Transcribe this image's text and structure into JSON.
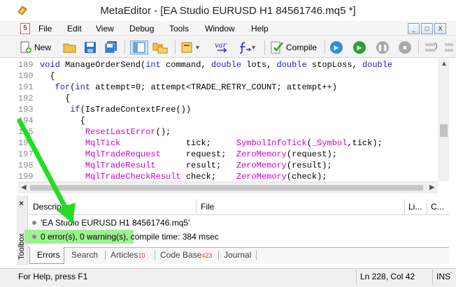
{
  "window": {
    "title": "MetaEditor - [EA Studio EURUSD H1 84561746.mq5 *]"
  },
  "menu": [
    "File",
    "Edit",
    "View",
    "Debug",
    "Tools",
    "Window",
    "Help"
  ],
  "window_controls": [
    "_",
    "□",
    "X"
  ],
  "toolbar": {
    "new_label": "New",
    "compile_label": "Compile",
    "var_label": "var"
  },
  "editor": {
    "lines": [
      {
        "num": "189",
        "parts": [
          {
            "t": "kw",
            "s": "void "
          },
          {
            "t": "tx",
            "s": "ManageOrderSend("
          },
          {
            "t": "kw",
            "s": "int"
          },
          {
            "t": "tx",
            "s": " command, "
          },
          {
            "t": "kw",
            "s": "double"
          },
          {
            "t": "tx",
            "s": " lots, "
          },
          {
            "t": "kw",
            "s": "double"
          },
          {
            "t": "tx",
            "s": " stopLoss, "
          },
          {
            "t": "kw",
            "s": "double"
          }
        ]
      },
      {
        "num": "190",
        "parts": [
          {
            "t": "tx",
            "s": "  {"
          }
        ]
      },
      {
        "num": "191",
        "parts": [
          {
            "t": "tx",
            "s": "   "
          },
          {
            "t": "kw",
            "s": "for"
          },
          {
            "t": "tx",
            "s": "("
          },
          {
            "t": "kw",
            "s": "int"
          },
          {
            "t": "tx",
            "s": " attempt=0; attempt<TRADE_RETRY_COUNT; attempt++)"
          }
        ]
      },
      {
        "num": "192",
        "parts": [
          {
            "t": "tx",
            "s": "     {"
          }
        ]
      },
      {
        "num": "193",
        "parts": [
          {
            "t": "tx",
            "s": "      "
          },
          {
            "t": "kw",
            "s": "if"
          },
          {
            "t": "tx",
            "s": "(IsTradeContextFree())"
          }
        ]
      },
      {
        "num": "194",
        "parts": [
          {
            "t": "tx",
            "s": "        {"
          }
        ]
      },
      {
        "num": "195",
        "parts": [
          {
            "t": "tx",
            "s": "         "
          },
          {
            "t": "fn",
            "s": "ResetLastError"
          },
          {
            "t": "tx",
            "s": "();"
          }
        ]
      },
      {
        "num": "196",
        "parts": [
          {
            "t": "tx",
            "s": "         "
          },
          {
            "t": "fn",
            "s": "MqlTick"
          },
          {
            "t": "tx",
            "s": "             tick;     "
          },
          {
            "t": "fn",
            "s": "SymbolInfoTick"
          },
          {
            "t": "tx",
            "s": "("
          },
          {
            "t": "fn",
            "s": "_Symbol"
          },
          {
            "t": "tx",
            "s": ",tick);"
          }
        ]
      },
      {
        "num": "197",
        "parts": [
          {
            "t": "tx",
            "s": "         "
          },
          {
            "t": "fn",
            "s": "MqlTradeRequest"
          },
          {
            "t": "tx",
            "s": "     request;  "
          },
          {
            "t": "fn",
            "s": "ZeroMemory"
          },
          {
            "t": "tx",
            "s": "(request);"
          }
        ]
      },
      {
        "num": "198",
        "parts": [
          {
            "t": "tx",
            "s": "         "
          },
          {
            "t": "fn",
            "s": "MqlTradeResult"
          },
          {
            "t": "tx",
            "s": "      result;   "
          },
          {
            "t": "fn",
            "s": "ZeroMemory"
          },
          {
            "t": "tx",
            "s": "(result);"
          }
        ]
      },
      {
        "num": "199",
        "parts": [
          {
            "t": "tx",
            "s": "         "
          },
          {
            "t": "fn",
            "s": "MqlTradeCheckResult"
          },
          {
            "t": "tx",
            "s": " check;    "
          },
          {
            "t": "fn",
            "s": "ZeroMemory"
          },
          {
            "t": "tx",
            "s": "(check);"
          }
        ]
      }
    ]
  },
  "toolbox": {
    "label": "Toolbox",
    "close": "×",
    "columns": {
      "description": "Description",
      "file": "File",
      "line": "Li...",
      "col": "C..."
    },
    "rows": [
      {
        "text": "'EA Studio EURUSD H1 84561746.mq5'"
      },
      {
        "text": "0 error(s), 0 warning(s), compile time: 384 msec"
      }
    ],
    "tabs": [
      {
        "label": "Errors",
        "badge": ""
      },
      {
        "label": "Search",
        "badge": ""
      },
      {
        "label": "Articles",
        "badge": "10"
      },
      {
        "label": "Code Base",
        "badge": "423"
      },
      {
        "label": "Journal",
        "badge": ""
      }
    ]
  },
  "status": {
    "help": "For Help, press F1",
    "position": "Ln 228, Col 42",
    "mode": "INS"
  },
  "colors": {
    "highlight": "#9ef291",
    "annotation_arrow": "#22dd22",
    "badge": "#e23a1a"
  }
}
